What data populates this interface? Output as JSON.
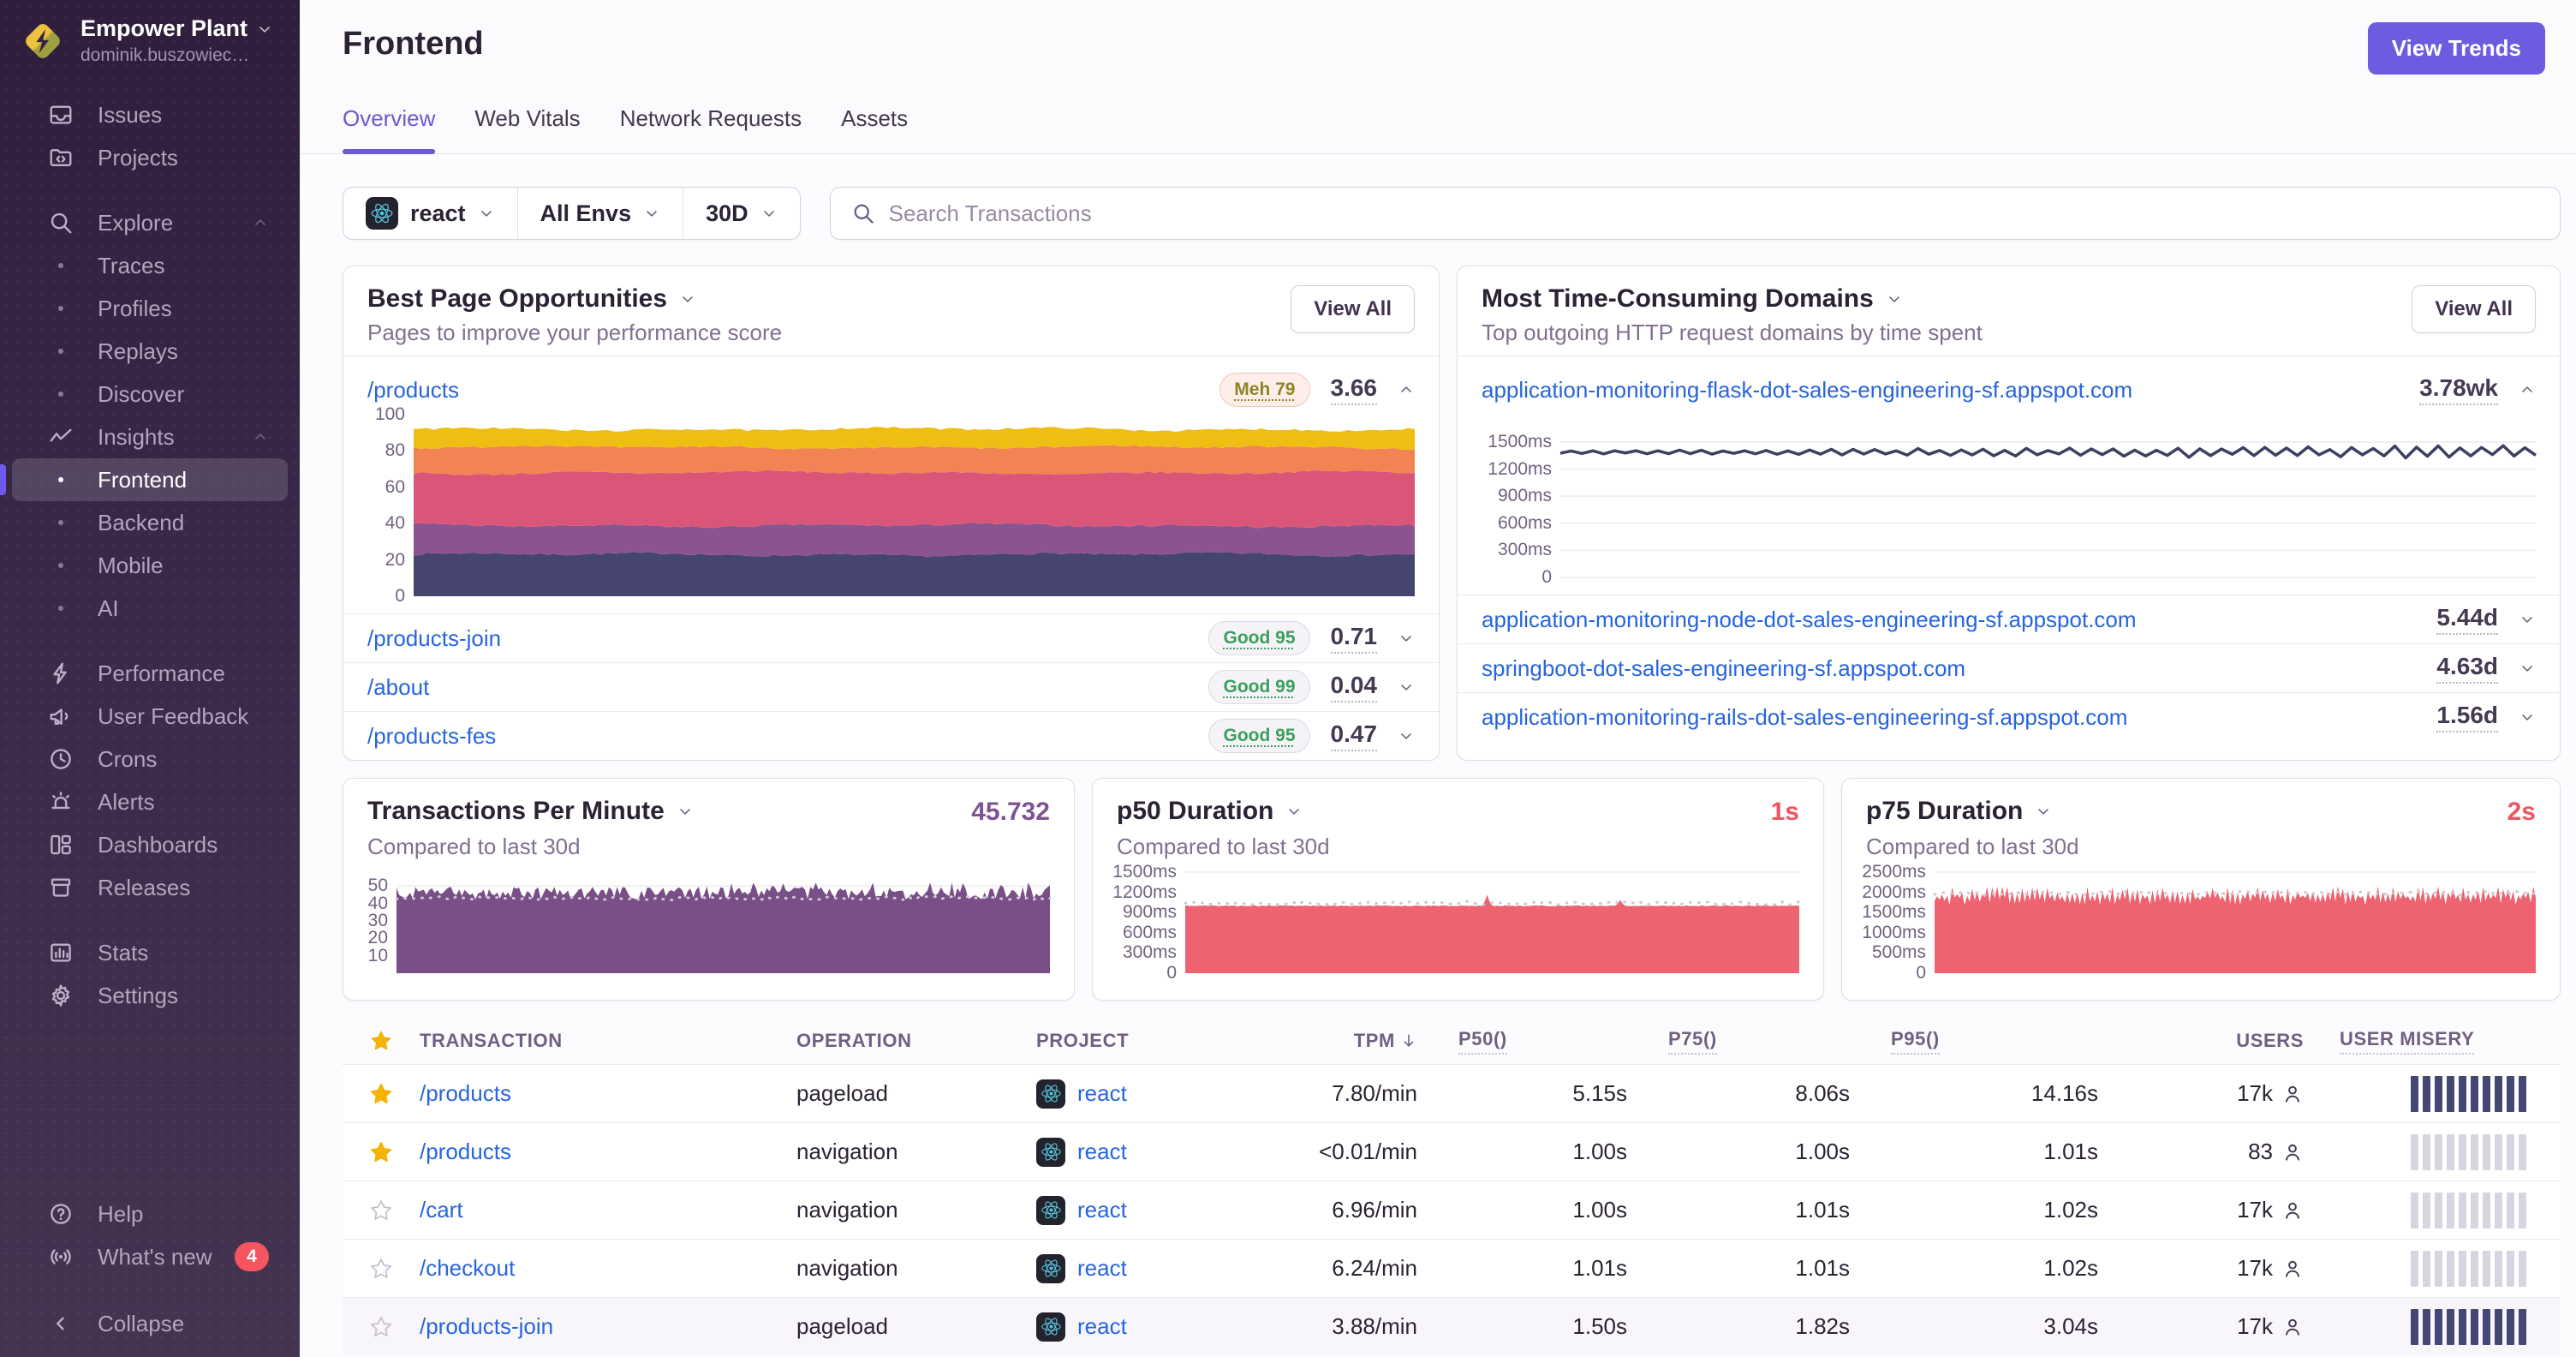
{
  "colors": {
    "accent_purple": "#6d5be0",
    "link_blue": "#2765dd",
    "star_yellow": "#f5b301",
    "red": "#f1545c",
    "value_purple": "#7c5393",
    "misery_high": "#444674",
    "misery_low": "#d9d5e0"
  },
  "sidebar": {
    "org_name": "Empower Plant",
    "org_email": "dominik.buszowiec…",
    "items": {
      "issues": "Issues",
      "projects": "Projects",
      "explore": "Explore",
      "traces": "Traces",
      "profiles": "Profiles",
      "replays": "Replays",
      "discover": "Discover",
      "insights": "Insights",
      "frontend": "Frontend",
      "backend": "Backend",
      "mobile": "Mobile",
      "ai": "AI",
      "performance": "Performance",
      "user_feedback": "User Feedback",
      "crons": "Crons",
      "alerts": "Alerts",
      "dashboards": "Dashboards",
      "releases": "Releases",
      "stats": "Stats",
      "settings": "Settings",
      "help": "Help",
      "whats_new": "What's new",
      "collapse": "Collapse"
    },
    "whats_new_badge": "4"
  },
  "header": {
    "title": "Frontend",
    "view_trends": "View Trends",
    "tabs": [
      "Overview",
      "Web Vitals",
      "Network Requests",
      "Assets"
    ]
  },
  "filters": {
    "project": "react",
    "env": "All Envs",
    "period": "30D",
    "search_placeholder": "Search Transactions"
  },
  "opportunities": {
    "title": "Best Page Opportunities",
    "subtitle": "Pages to improve your performance score",
    "view_all": "View All",
    "rows": [
      {
        "page": "/products",
        "badge": "Meh 79",
        "score": "3.66"
      },
      {
        "page": "/products-join",
        "badge": "Good 95",
        "score": "0.71"
      },
      {
        "page": "/about",
        "badge": "Good 99",
        "score": "0.04"
      },
      {
        "page": "/products-fes",
        "badge": "Good 95",
        "score": "0.47"
      }
    ],
    "chart_data": {
      "type": "area",
      "stacked": true,
      "title": "/products performance score breakdown over 30d",
      "ylim": [
        0,
        100
      ],
      "yticks": [
        {
          "v": 100,
          "label": "100"
        },
        {
          "v": 80,
          "label": "80"
        },
        {
          "v": 60,
          "label": "60"
        },
        {
          "v": 40,
          "label": "40"
        },
        {
          "v": 20,
          "label": "20"
        },
        {
          "v": 0,
          "label": "0"
        }
      ],
      "stack_boundaries": [
        23,
        39,
        68,
        82,
        92
      ],
      "colors": [
        "#454570",
        "#8b5392",
        "#da5678",
        "#f28352",
        "#efbe13"
      ]
    }
  },
  "domains": {
    "title": "Most Time-Consuming Domains",
    "subtitle": "Top outgoing HTTP request domains by time spent",
    "view_all": "View All",
    "rows": [
      {
        "domain": "application-monitoring-flask-dot-sales-engineering-sf.appspot.com",
        "time": "3.78wk"
      },
      {
        "domain": "application-monitoring-node-dot-sales-engineering-sf.appspot.com",
        "time": "5.44d"
      },
      {
        "domain": "springboot-dot-sales-engineering-sf.appspot.com",
        "time": "4.63d"
      },
      {
        "domain": "application-monitoring-rails-dot-sales-engineering-sf.appspot.com",
        "time": "1.56d"
      }
    ],
    "chart_data": {
      "type": "line",
      "ylim": [
        0,
        1500
      ],
      "yticks": [
        {
          "v": 1500,
          "label": "1500ms"
        },
        {
          "v": 1200,
          "label": "1200ms"
        },
        {
          "v": 900,
          "label": "900ms"
        },
        {
          "v": 600,
          "label": "600ms"
        },
        {
          "v": 300,
          "label": "300ms"
        },
        {
          "v": 0,
          "label": "0"
        }
      ],
      "y_approx": 1400,
      "color": "#3f3f63",
      "grid": true
    }
  },
  "metrics": [
    {
      "title": "Transactions Per Minute",
      "subtitle": "Compared to last 30d",
      "value": "45.732",
      "chart_data": {
        "type": "area",
        "style": "noisy",
        "ylim": [
          0,
          58
        ],
        "yticks": [
          {
            "v": 50,
            "label": "50"
          },
          {
            "v": 40,
            "label": "40"
          },
          {
            "v": 30,
            "label": "30"
          },
          {
            "v": 20,
            "label": "20"
          },
          {
            "v": 10,
            "label": "10"
          }
        ],
        "y_range": [
          40,
          52
        ],
        "color": "#784f87",
        "compare_y": 43
      }
    },
    {
      "title": "p50 Duration",
      "subtitle": "Compared to last 30d",
      "value": "1s",
      "chart_data": {
        "type": "area",
        "style": "flat",
        "ylim": [
          0,
          1500
        ],
        "yticks": [
          {
            "v": 1500,
            "label": "1500ms"
          },
          {
            "v": 1200,
            "label": "1200ms"
          },
          {
            "v": 900,
            "label": "900ms"
          },
          {
            "v": 600,
            "label": "600ms"
          },
          {
            "v": 300,
            "label": "300ms"
          },
          {
            "v": 0,
            "label": "0"
          }
        ],
        "y_flat": 1000,
        "spikes": [
          {
            "x": 0.49,
            "y": 1165
          },
          {
            "x": 0.71,
            "y": 1085
          }
        ],
        "color": "#ee6370",
        "compare_y": 1040
      }
    },
    {
      "title": "p75 Duration",
      "subtitle": "Compared to last 30d",
      "value": "2s",
      "chart_data": {
        "type": "area",
        "style": "zigzag",
        "ylim": [
          0,
          2500
        ],
        "yticks": [
          {
            "v": 2500,
            "label": "2500ms"
          },
          {
            "v": 2000,
            "label": "2000ms"
          },
          {
            "v": 1500,
            "label": "1500ms"
          },
          {
            "v": 1000,
            "label": "1000ms"
          },
          {
            "v": 500,
            "label": "500ms"
          },
          {
            "v": 0,
            "label": "0"
          }
        ],
        "y_range": [
          1600,
          2150
        ],
        "color": "#ee6370",
        "compare_y": 1980
      }
    }
  ],
  "table": {
    "headers": {
      "transaction": "TRANSACTION",
      "operation": "OPERATION",
      "project": "PROJECT",
      "tpm": "TPM",
      "p50": "P50()",
      "p75": "P75()",
      "p95": "P95()",
      "users": "USERS",
      "misery": "USER MISERY"
    },
    "rows": [
      {
        "starred": true,
        "transaction": "/products",
        "operation": "pageload",
        "project": "react",
        "tpm": "7.80/min",
        "p50": "5.15s",
        "p75": "8.06s",
        "p95": "14.16s",
        "users": "17k",
        "misery": "high"
      },
      {
        "starred": true,
        "transaction": "/products",
        "operation": "navigation",
        "project": "react",
        "tpm": "<0.01/min",
        "p50": "1.00s",
        "p75": "1.00s",
        "p95": "1.01s",
        "users": "83",
        "misery": "low"
      },
      {
        "starred": false,
        "transaction": "/cart",
        "operation": "navigation",
        "project": "react",
        "tpm": "6.96/min",
        "p50": "1.00s",
        "p75": "1.01s",
        "p95": "1.02s",
        "users": "17k",
        "misery": "low"
      },
      {
        "starred": false,
        "transaction": "/checkout",
        "operation": "navigation",
        "project": "react",
        "tpm": "6.24/min",
        "p50": "1.01s",
        "p75": "1.01s",
        "p95": "1.02s",
        "users": "17k",
        "misery": "low"
      },
      {
        "starred": false,
        "transaction": "/products-join",
        "operation": "pageload",
        "project": "react",
        "tpm": "3.88/min",
        "p50": "1.50s",
        "p75": "1.82s",
        "p95": "3.04s",
        "users": "17k",
        "misery": "high"
      }
    ]
  }
}
